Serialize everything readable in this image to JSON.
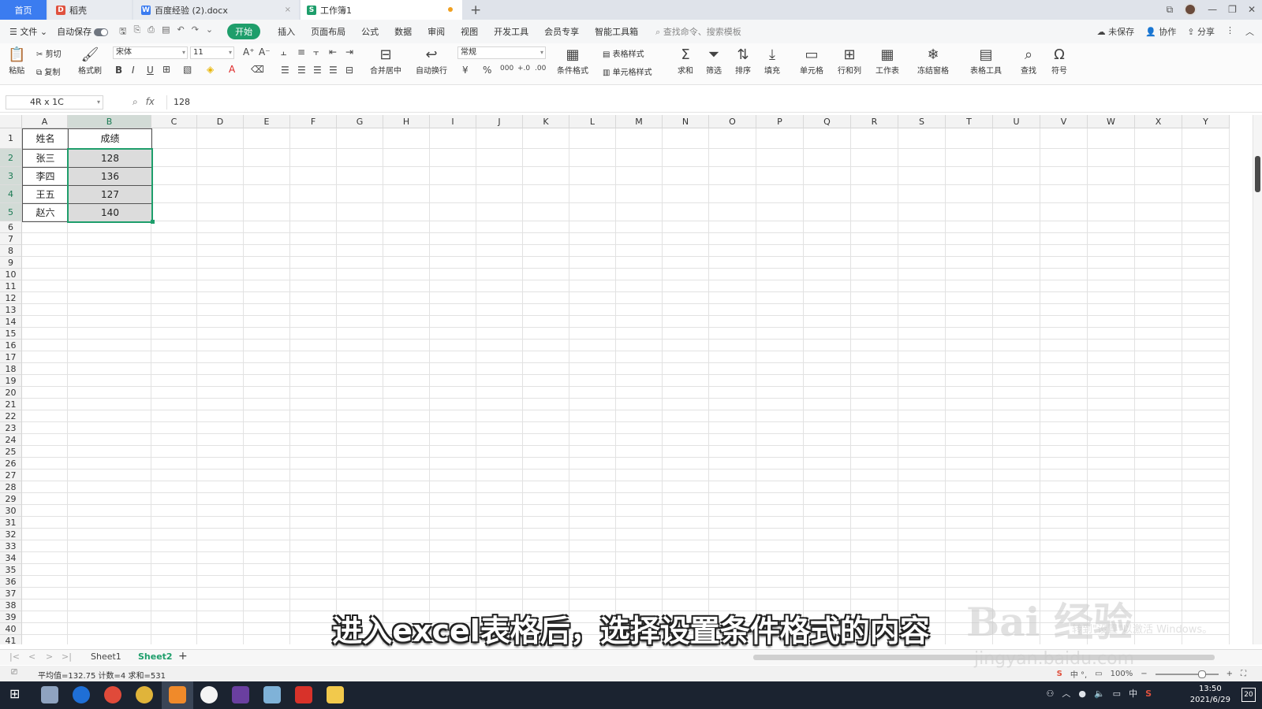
{
  "tabs": {
    "home": "首页",
    "docer": "稻壳",
    "doc": "百度经验 (2).docx",
    "book": "工作簿1",
    "doc_close": "×",
    "add": "+"
  },
  "menubar": {
    "file": "文件",
    "autosave": "自动保存",
    "items": [
      "开始",
      "插入",
      "页面布局",
      "公式",
      "数据",
      "审阅",
      "视图",
      "开发工具",
      "会员专享",
      "智能工具箱"
    ],
    "search": "查找命令、搜索模板",
    "unsaved": "未保存",
    "collab": "协作",
    "share": "分享"
  },
  "ribbon": {
    "paste": "粘贴",
    "cut": "剪切",
    "copy": "复制",
    "format_painter": "格式刷",
    "font_name": "宋体",
    "font_size": "11",
    "merge_center": "合并居中",
    "wrap": "自动换行",
    "number_format": "常规",
    "cond_format": "条件格式",
    "table_style": "表格样式",
    "cell_style": "单元格样式",
    "sum": "求和",
    "filter": "筛选",
    "sort": "排序",
    "fill": "填充",
    "cell": "单元格",
    "row_col": "行和列",
    "worksheet": "工作表",
    "freeze": "冻结窗格",
    "table_tools": "表格工具",
    "find": "查找",
    "symbol": "符号"
  },
  "formula_bar": {
    "name_box": "4R x 1C",
    "fx": "fx",
    "value": "128"
  },
  "grid": {
    "columns": [
      "A",
      "B",
      "C",
      "D",
      "E",
      "F",
      "G",
      "H",
      "I",
      "J",
      "K",
      "L",
      "M",
      "N",
      "O",
      "P",
      "Q",
      "R",
      "S",
      "T",
      "U",
      "V",
      "W",
      "X",
      "Y"
    ],
    "rows": [
      "1",
      "2",
      "3",
      "4",
      "5",
      "6",
      "7",
      "8",
      "9",
      "10",
      "11",
      "12",
      "13",
      "14",
      "15",
      "16",
      "17",
      "18",
      "19",
      "20",
      "21",
      "22",
      "23",
      "24",
      "25",
      "26",
      "27",
      "28",
      "29",
      "30",
      "31",
      "32",
      "33",
      "34",
      "35",
      "36",
      "37",
      "38",
      "39",
      "40",
      "41"
    ],
    "header": [
      "姓名",
      "成绩"
    ],
    "data": [
      [
        "张三",
        "128"
      ],
      [
        "李四",
        "136"
      ],
      [
        "王五",
        "127"
      ],
      [
        "赵六",
        "140"
      ]
    ]
  },
  "sheets": {
    "tabs": [
      "Sheet1",
      "Sheet2"
    ],
    "active": "Sheet2",
    "add": "+"
  },
  "status": {
    "text": "平均值=132.75  计数=4  求和=531",
    "zoom": "100%"
  },
  "taskbar": {
    "time": "13:50",
    "date": "2021/6/29",
    "ime": "中",
    "notifications": "20"
  },
  "overlay": {
    "subtitle": "进入excel表格后，选择设置条件格式的内容",
    "watermark_main": "Bai 经验",
    "watermark_url": "jingyan.baidu.com",
    "watermark_win": "转到\"设置\"以激活 Windows。"
  },
  "colors": {
    "accent": "#1e9e6b",
    "home_tab": "#3b7cf0",
    "selection": "#1e9e6b"
  }
}
